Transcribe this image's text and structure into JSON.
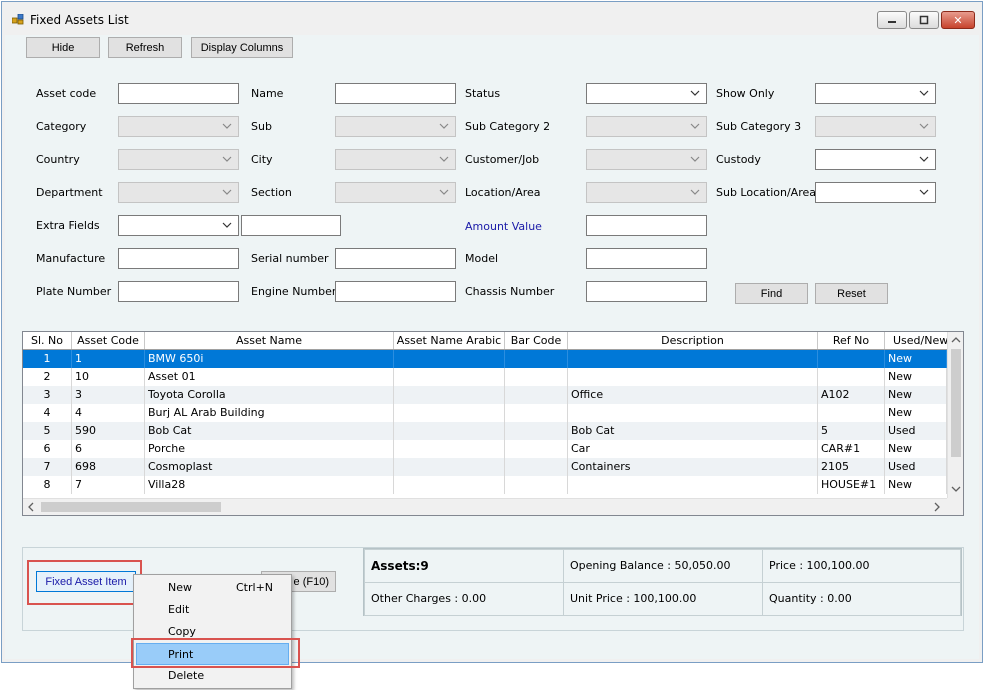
{
  "window": {
    "title": "Fixed Assets List",
    "controls": {
      "minimize": "",
      "maximize": "",
      "close": "✕"
    }
  },
  "toolbar": {
    "hide": "Hide",
    "refresh": "Refresh",
    "display_columns": "Display Columns"
  },
  "filters": {
    "asset_code": "Asset code",
    "name": "Name",
    "status": "Status",
    "show_only": "Show Only",
    "category": "Category",
    "sub": "Sub",
    "sub_category_2": "Sub Category 2",
    "sub_category_3": "Sub Category 3",
    "country": "Country",
    "city": "City",
    "customer_job": "Customer/Job",
    "custody": "Custody",
    "department": "Department",
    "section": "Section",
    "location_area": "Location/Area",
    "sub_location_area": "Sub Location/Area",
    "extra_fields": "Extra Fields",
    "amount_value": "Amount Value",
    "manufacture": "Manufacture",
    "serial_number": "Serial number",
    "model": "Model",
    "plate_number": "Plate Number",
    "engine_number": "Engine Number",
    "chassis_number": "Chassis Number",
    "find": "Find",
    "reset": "Reset"
  },
  "grid": {
    "columns": [
      "Sl. No",
      "Asset Code",
      "Asset Name",
      "Asset Name Arabic",
      "Bar Code",
      "Description",
      "Ref No",
      "Used/New"
    ],
    "rows": [
      {
        "sl": "1",
        "code": "1",
        "name": "BMW 650i",
        "arabic": "",
        "barcode": "",
        "desc": "",
        "ref": "",
        "used": "New"
      },
      {
        "sl": "2",
        "code": "10",
        "name": "Asset 01",
        "arabic": "",
        "barcode": "",
        "desc": "",
        "ref": "",
        "used": "New"
      },
      {
        "sl": "3",
        "code": "3",
        "name": "Toyota Corolla",
        "arabic": "",
        "barcode": "",
        "desc": "Office",
        "ref": "A102",
        "used": "New"
      },
      {
        "sl": "4",
        "code": "4",
        "name": "Burj AL Arab Building",
        "arabic": "",
        "barcode": "",
        "desc": "",
        "ref": "",
        "used": "New"
      },
      {
        "sl": "5",
        "code": "590",
        "name": "Bob Cat",
        "arabic": "",
        "barcode": "",
        "desc": "Bob Cat",
        "ref": "5",
        "used": "Used"
      },
      {
        "sl": "6",
        "code": "6",
        "name": "Porche",
        "arabic": "",
        "barcode": "",
        "desc": "Car",
        "ref": "CAR#1",
        "used": "New"
      },
      {
        "sl": "7",
        "code": "698",
        "name": "Cosmoplast",
        "arabic": "",
        "barcode": "",
        "desc": "Containers",
        "ref": "2105",
        "used": "Used"
      },
      {
        "sl": "8",
        "code": "7",
        "name": "Villa28",
        "arabic": "",
        "barcode": "",
        "desc": "",
        "ref": "HOUSE#1",
        "used": "New"
      }
    ]
  },
  "bottom": {
    "fixed_asset_item": "Fixed Asset Item",
    "hidden_button": "e (F10)"
  },
  "summary": {
    "assets": "Assets:9",
    "opening_balance": "Opening Balance  : 50,050.00",
    "price": "Price  : 100,100.00",
    "other_charges": "Other Charges  : 0.00",
    "unit_price": "Unit Price  : 100,100.00",
    "quantity": "Quantity  : 0.00"
  },
  "context_menu": {
    "items": [
      {
        "label": "New",
        "shortcut": "Ctrl+N"
      },
      {
        "label": "Edit",
        "shortcut": ""
      },
      {
        "label": "Copy",
        "shortcut": ""
      },
      {
        "label": "Print",
        "shortcut": ""
      },
      {
        "label": "Delete",
        "shortcut": ""
      }
    ]
  },
  "colors": {
    "selection": "#0078d7",
    "highlight": "#99ccf9",
    "annotation": "#d9534f",
    "link_blue": "#1a1aa8"
  }
}
